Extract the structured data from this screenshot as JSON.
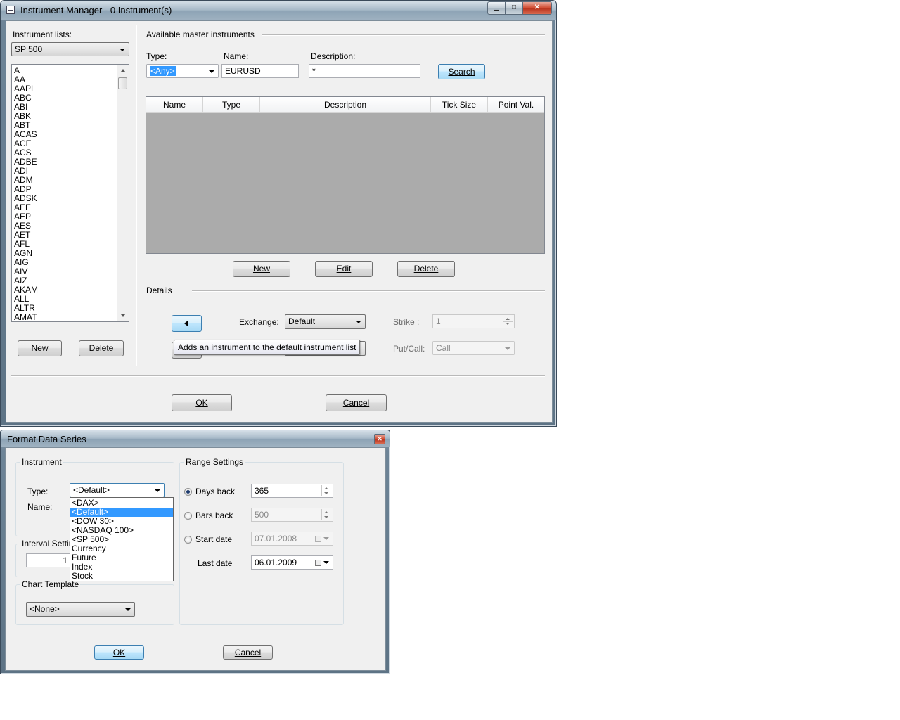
{
  "instrument_manager": {
    "title": "Instrument Manager - 0 Instrument(s)",
    "instrument_lists_label": "Instrument lists:",
    "instrument_list_selected": "SP 500",
    "list_items": [
      "A",
      "AA",
      "AAPL",
      "ABC",
      "ABI",
      "ABK",
      "ABT",
      "ACAS",
      "ACE",
      "ACS",
      "ADBE",
      "ADI",
      "ADM",
      "ADP",
      "ADSK",
      "AEE",
      "AEP",
      "AES",
      "AET",
      "AFL",
      "AGN",
      "AIG",
      "AIV",
      "AIZ",
      "AKAM",
      "ALL",
      "ALTR",
      "AMAT"
    ],
    "left_new_label": "New",
    "left_delete_label": "Delete",
    "available_master_label": "Available master instruments",
    "type_label": "Type:",
    "type_value": "<Any>",
    "name_label": "Name:",
    "name_value": "EURUSD",
    "description_label": "Description:",
    "description_value": "*",
    "search_label": "Search",
    "grid_columns": [
      "Name",
      "Type",
      "Description",
      "Tick Size",
      "Point Val."
    ],
    "new_label": "New",
    "edit_label": "Edit",
    "delete_label": "Delete",
    "details_label": "Details",
    "exchange_label": "Exchange:",
    "exchange_value": "Default",
    "strike_label": "Strike :",
    "strike_value": "1",
    "putcall_label": "Put/Call:",
    "putcall_value": "Call",
    "tooltip": "Adds an instrument to the default instrument list",
    "ok_label": "OK",
    "cancel_label": "Cancel"
  },
  "format_data_series": {
    "title": "Format Data Series",
    "instrument_group": "Instrument",
    "type_label": "Type:",
    "type_value": "<Default>",
    "name_label": "Name:",
    "dropdown_options": [
      "<DAX>",
      "<Default>",
      "<DOW 30>",
      "<NASDAQ 100>",
      "<SP 500>",
      "Currency",
      "Future",
      "Index",
      "Stock"
    ],
    "dropdown_selected_index": 1,
    "interval_group": "Interval Setting",
    "interval_value": "1",
    "chart_template_group": "Chart Template",
    "chart_template_value": "<None>",
    "range_group": "Range Settings",
    "days_back_label": "Days back",
    "days_back_value": "365",
    "bars_back_label": "Bars back",
    "bars_back_value": "500",
    "start_date_label": "Start date",
    "start_date_value": "07.01.2008",
    "last_date_label": "Last date",
    "last_date_value": "06.01.2009",
    "ok_label": "OK",
    "cancel_label": "Cancel"
  }
}
